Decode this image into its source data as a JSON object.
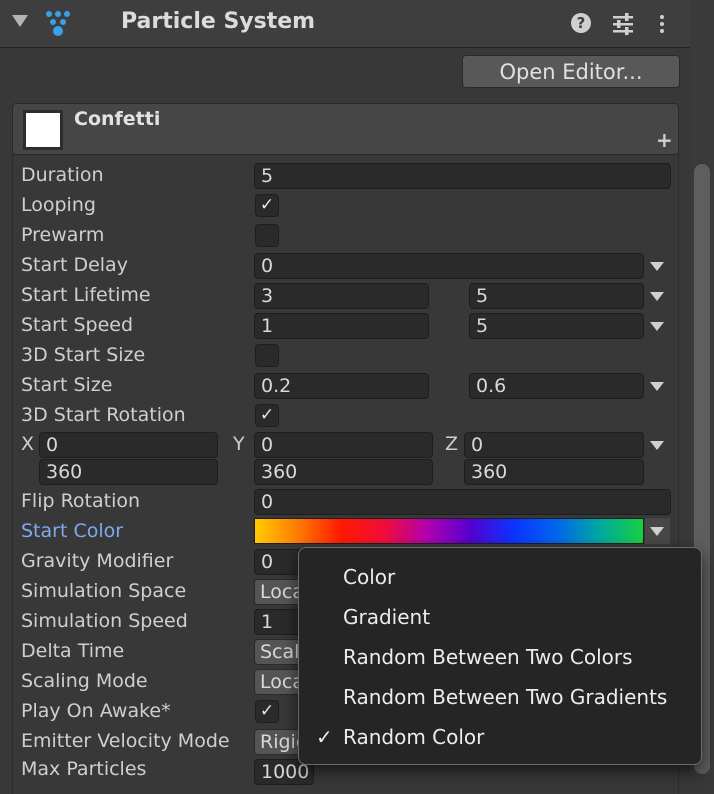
{
  "header": {
    "title": "Particle System",
    "help_glyph": "?",
    "icons": [
      "chevron-down-icon",
      "particle-system-icon",
      "help-icon",
      "presets-icon",
      "more-options-icon"
    ]
  },
  "open_editor_label": "Open Editor...",
  "module": {
    "name": "Confetti",
    "add_glyph": "+"
  },
  "properties": {
    "duration": {
      "label": "Duration",
      "value": "5"
    },
    "looping": {
      "label": "Looping",
      "checked": true
    },
    "prewarm": {
      "label": "Prewarm",
      "checked": false
    },
    "start_delay": {
      "label": "Start Delay",
      "value": "0"
    },
    "start_lifetime": {
      "label": "Start Lifetime",
      "min": "3",
      "max": "5"
    },
    "start_speed": {
      "label": "Start Speed",
      "min": "1",
      "max": "5"
    },
    "start_size_3d": {
      "label": "3D Start Size",
      "checked": false
    },
    "start_size": {
      "label": "Start Size",
      "min": "0.2",
      "max": "0.6"
    },
    "start_rotation_3d": {
      "label": "3D Start Rotation",
      "checked": true
    },
    "rotation": {
      "x_label": "X",
      "y_label": "Y",
      "z_label": "Z",
      "x_min": "0",
      "y_min": "0",
      "z_min": "0",
      "x_max": "360",
      "y_max": "360",
      "z_max": "360"
    },
    "flip_rotation": {
      "label": "Flip Rotation",
      "value": "0"
    },
    "start_color": {
      "label": "Start Color",
      "gradient": [
        "#ffcc00",
        "#ff7a00",
        "#ff1a00",
        "#f00d3a",
        "#b000b0",
        "#5500d0",
        "#0d33ff",
        "#0066ee",
        "#00a8a0",
        "#18d040"
      ]
    },
    "gravity_modifier": {
      "label": "Gravity Modifier",
      "value": "0"
    },
    "simulation_space": {
      "label": "Simulation Space",
      "value": "Loca"
    },
    "simulation_speed": {
      "label": "Simulation Speed",
      "value": "1"
    },
    "delta_time": {
      "label": "Delta Time",
      "value": "Scal"
    },
    "scaling_mode": {
      "label": "Scaling Mode",
      "value": "Loca"
    },
    "play_on_awake": {
      "label": "Play On Awake*",
      "checked": true
    },
    "emitter_velocity_mode": {
      "label": "Emitter Velocity Mode",
      "value": "Rigic"
    },
    "max_particles": {
      "label": "Max Particles",
      "value": "1000"
    }
  },
  "check_glyph": "✓",
  "color_mode_menu": {
    "items": [
      "Color",
      "Gradient",
      "Random Between Two Colors",
      "Random Between Two Gradients",
      "Random Color"
    ],
    "selected": "Random Color",
    "selected_glyph": "✓"
  }
}
